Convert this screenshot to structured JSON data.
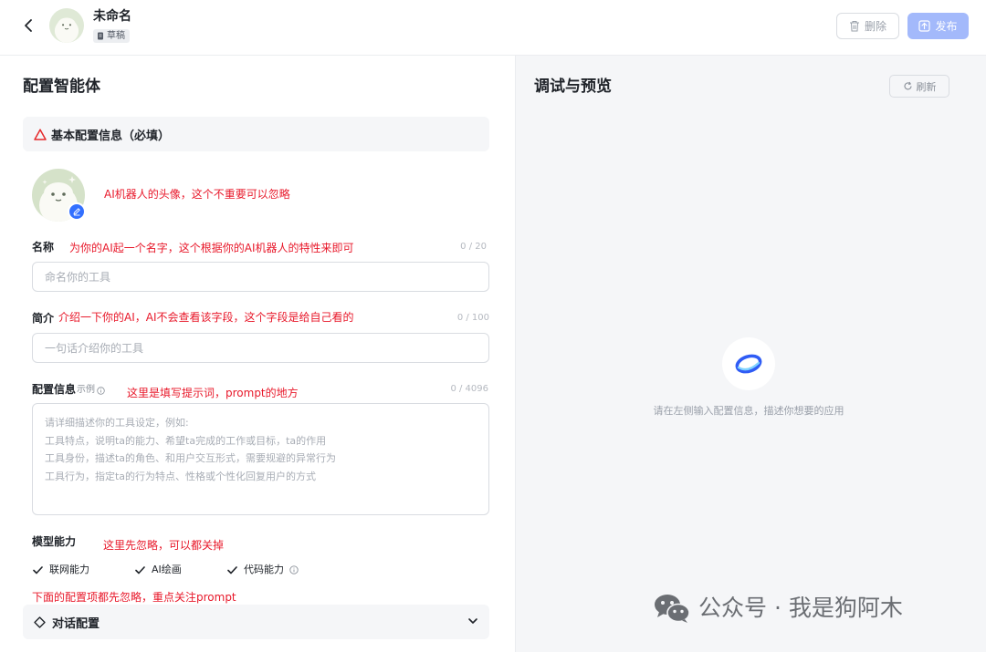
{
  "header": {
    "app_name": "未命名",
    "draft_badge": "草稿",
    "delete_label": "删除",
    "publish_label": "发布"
  },
  "left": {
    "title": "配置智能体",
    "basic_section": "基本配置信息（必填）",
    "avatar_note": "AI机器人的头像，这个不重要可以忽略",
    "name": {
      "label": "名称",
      "note": "为你的AI起一个名字，这个根据你的AI机器人的特性来即可",
      "counter": "0 / 20",
      "placeholder": "命名你的工具"
    },
    "intro": {
      "label": "简介",
      "note": "介绍一下你的AI，AI不会查看该字段，这个字段是给自己看的",
      "counter": "0 / 100",
      "placeholder": "一句话介绍你的工具"
    },
    "config": {
      "label": "配置信息",
      "example": "示例",
      "note": "这里是填写提示词，prompt的地方",
      "counter": "0 / 4096",
      "placeholder_lines": [
        "请详细描述你的工具设定，例如:",
        "工具特点，说明ta的能力、希望ta完成的工作或目标，ta的作用",
        "工具身份，描述ta的角色、和用户交互形式，需要规避的异常行为",
        "工具行为，指定ta的行为特点、性格或个性化回复用户的方式"
      ]
    },
    "model": {
      "label": "模型能力",
      "note": "这里先忽略，可以都关掉",
      "options": [
        {
          "label": "联网能力",
          "checked": true
        },
        {
          "label": "AI绘画",
          "checked": true
        },
        {
          "label": "代码能力",
          "checked": true
        }
      ]
    },
    "bottom_note": "下面的配置项都先忽略，重点关注prompt",
    "dialog_section": "对话配置"
  },
  "right": {
    "title": "调试与预览",
    "refresh_label": "刷新",
    "empty_hint": "请在左侧输入配置信息，描述你想要的应用",
    "watermark": "公众号 · 我是狗阿木"
  },
  "colors": {
    "accent": "#3370ff",
    "publish_bg": "#a3b9fb",
    "annotation": "#e8182a",
    "warning_icon": "#e5292b"
  }
}
